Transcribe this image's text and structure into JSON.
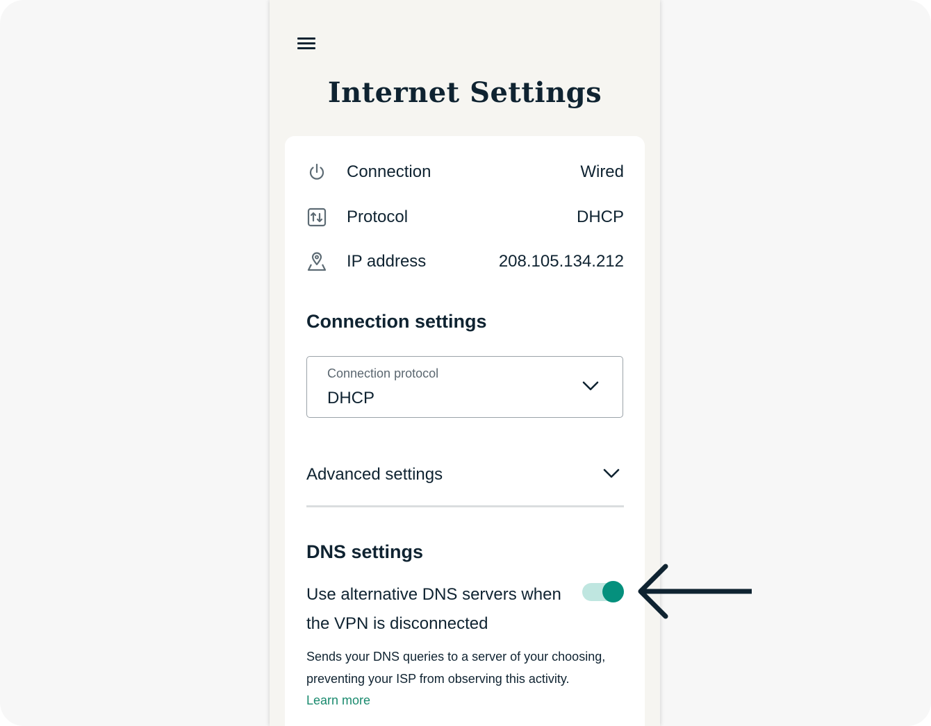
{
  "header": {
    "menu_icon": "hamburger-menu-icon",
    "title": "Internet Settings"
  },
  "info": {
    "rows": [
      {
        "icon": "power-icon",
        "label": "Connection",
        "value": "Wired"
      },
      {
        "icon": "protocol-swap-icon",
        "label": "Protocol",
        "value": "DHCP"
      },
      {
        "icon": "location-person-icon",
        "label": "IP address",
        "value": "208.105.134.212"
      }
    ]
  },
  "connection_settings": {
    "title": "Connection settings",
    "protocol_select": {
      "label": "Connection protocol",
      "value": "DHCP"
    }
  },
  "advanced": {
    "label": "Advanced settings"
  },
  "dns": {
    "title": "DNS settings",
    "toggle_label": "Use alternative DNS servers when the VPN is disconnected",
    "toggle_on": true,
    "description": "Sends your DNS queries to a server of your choosing, preventing your ISP from observing this activity.",
    "learn_more": "Learn more"
  },
  "colors": {
    "text": "#0f2331",
    "accent": "#05907d",
    "toggle_track": "#bfe6e0",
    "link": "#1a8a6e",
    "panel_bg": "#f6f5f1"
  }
}
